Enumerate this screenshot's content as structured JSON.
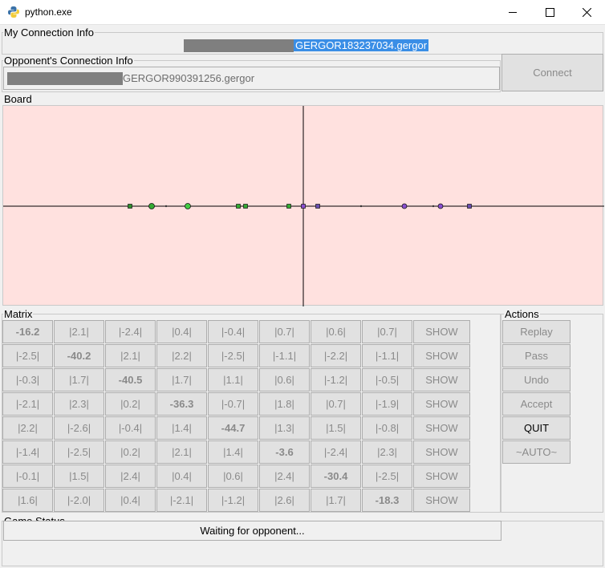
{
  "window": {
    "title": "python.exe",
    "buttons": [
      "minimize",
      "maximize",
      "close"
    ]
  },
  "my_connection": {
    "label": "My Connection Info",
    "address": "GERGOR183237034.gergor"
  },
  "opponent_connection": {
    "label": "Opponent's Connection Info",
    "address": "GERGOR990391256.gergor",
    "connect_label": "Connect"
  },
  "board": {
    "label": "Board",
    "background": "#ffe1df",
    "markers": [
      {
        "x": -2.4,
        "size": "small",
        "color": "#2f8f2f",
        "shape": "square"
      },
      {
        "x": -2.1,
        "size": "large",
        "color": "#33aa33",
        "shape": "circle"
      },
      {
        "x": -1.9,
        "size": "dot",
        "color": "#333333",
        "shape": "dot"
      },
      {
        "x": -1.6,
        "size": "large",
        "color": "#44cc44",
        "shape": "circle"
      },
      {
        "x": -0.9,
        "size": "small",
        "color": "#33aa33",
        "shape": "square"
      },
      {
        "x": -0.8,
        "size": "small",
        "color": "#33aa33",
        "shape": "square"
      },
      {
        "x": -0.2,
        "size": "small",
        "color": "#33aa33",
        "shape": "square"
      },
      {
        "x": 0.0,
        "size": "small",
        "color": "#8a4fd0",
        "shape": "square"
      },
      {
        "x": 0.2,
        "size": "small",
        "color": "#6a4fb0",
        "shape": "square"
      },
      {
        "x": 0.8,
        "size": "dot",
        "color": "#333333",
        "shape": "dot"
      },
      {
        "x": 1.4,
        "size": "medium",
        "color": "#8a4fd0",
        "shape": "circle"
      },
      {
        "x": 1.8,
        "size": "dot",
        "color": "#333333",
        "shape": "dot"
      },
      {
        "x": 1.9,
        "size": "medium",
        "color": "#8a4fd0",
        "shape": "circle"
      },
      {
        "x": 2.3,
        "size": "small",
        "color": "#6a4fb0",
        "shape": "square"
      }
    ]
  },
  "matrix": {
    "label": "Matrix",
    "show_label": "SHOW",
    "rows": [
      [
        "-16.2",
        "|2.1|",
        "|-2.4|",
        "|0.4|",
        "|-0.4|",
        "|0.7|",
        "|0.6|",
        "|0.7|"
      ],
      [
        "|-2.5|",
        "-40.2",
        "|2.1|",
        "|2.2|",
        "|-2.5|",
        "|-1.1|",
        "|-2.2|",
        "|-1.1|"
      ],
      [
        "|-0.3|",
        "|1.7|",
        "-40.5",
        "|1.7|",
        "|1.1|",
        "|0.6|",
        "|-1.2|",
        "|-0.5|"
      ],
      [
        "|-2.1|",
        "|2.3|",
        "|0.2|",
        "-36.3",
        "|-0.7|",
        "|1.8|",
        "|0.7|",
        "|-1.9|"
      ],
      [
        "|2.2|",
        "|-2.6|",
        "|-0.4|",
        "|1.4|",
        "-44.7",
        "|1.3|",
        "|1.5|",
        "|-0.8|"
      ],
      [
        "|-1.4|",
        "|-2.5|",
        "|0.2|",
        "|2.1|",
        "|1.4|",
        "-3.6",
        "|-2.4|",
        "|2.3|"
      ],
      [
        "|-0.1|",
        "|1.5|",
        "|2.4|",
        "|0.4|",
        "|0.6|",
        "|2.4|",
        "-30.4",
        "|-2.5|"
      ],
      [
        "|1.6|",
        "|-2.0|",
        "|0.4|",
        "|-2.1|",
        "|-1.2|",
        "|2.6|",
        "|1.7|",
        "-18.3"
      ]
    ]
  },
  "actions": {
    "label": "Actions",
    "replay": "Replay",
    "pass": "Pass",
    "undo": "Undo",
    "accept": "Accept",
    "quit": "QUIT",
    "auto": "~AUTO~"
  },
  "game_status": {
    "label": "Game Status",
    "text": "Waiting for opponent..."
  }
}
